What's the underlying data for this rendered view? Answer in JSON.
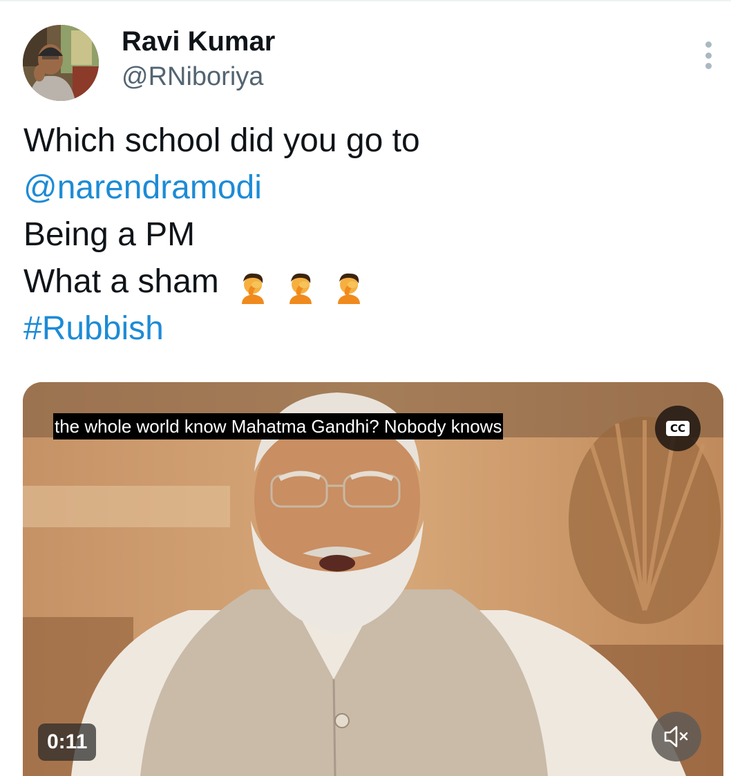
{
  "author": {
    "display_name": "Ravi Kumar",
    "handle": "@RNiboriya",
    "avatar_icon": "user-avatar"
  },
  "header": {
    "more_icon": "more-vertical-icon"
  },
  "tweet": {
    "line1": "Which school did you go to",
    "mention": "@narendramodi",
    "line3": "Being a PM",
    "line4": "What a sham",
    "emoji": "facepalm",
    "emoji_count": 3,
    "hashtag": "#Rubbish"
  },
  "video": {
    "caption": "the whole world know Mahatma Gandhi? Nobody knows",
    "cc_label": "CC",
    "duration": "0:11",
    "muted": true
  },
  "colors": {
    "text": "#0f1419",
    "secondary": "#536471",
    "link": "#1d8bd6"
  }
}
